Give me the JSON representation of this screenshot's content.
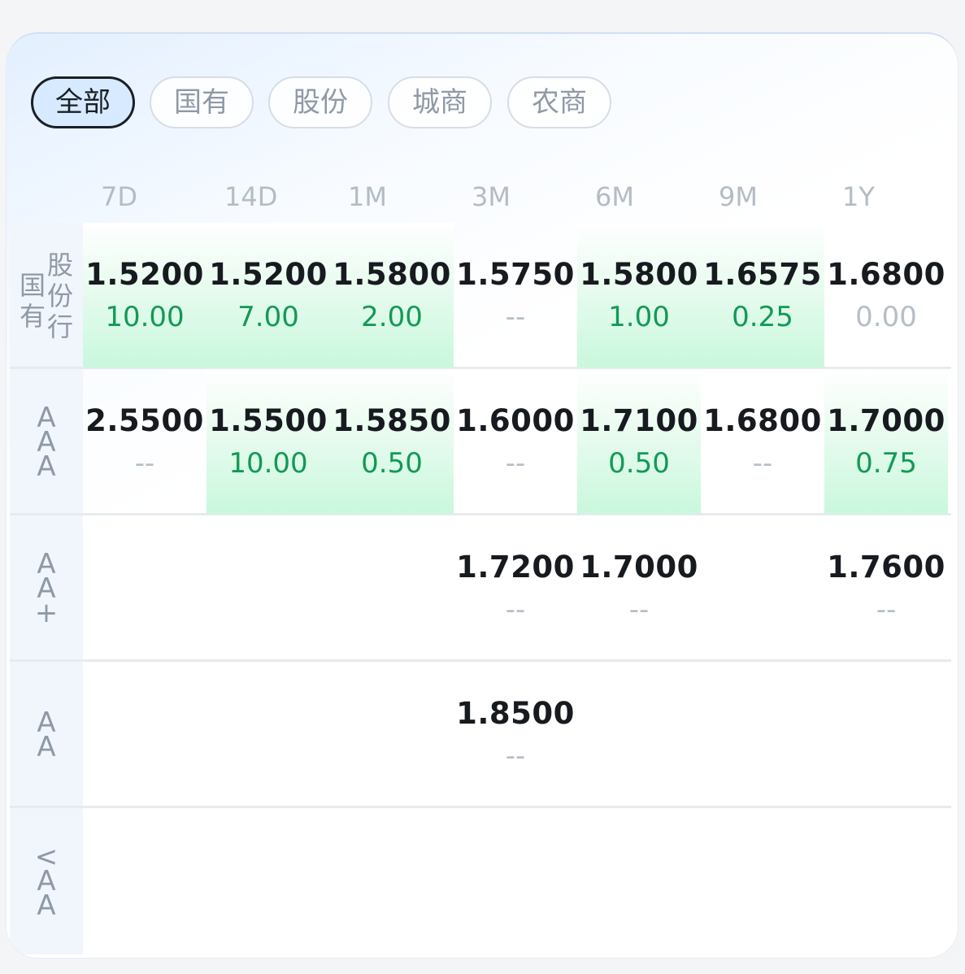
{
  "filters": [
    {
      "label": "全部",
      "active": true
    },
    {
      "label": "国有",
      "active": false
    },
    {
      "label": "股份",
      "active": false
    },
    {
      "label": "城商",
      "active": false
    },
    {
      "label": "农商",
      "active": false
    }
  ],
  "columns": [
    "7D",
    "14D",
    "1M",
    "3M",
    "6M",
    "9M",
    "1Y"
  ],
  "rows": [
    {
      "label_a": "国\n有",
      "label_b": "股\n份\n行",
      "cells": [
        {
          "value": "1.5200",
          "sub": "10.00",
          "state": "green"
        },
        {
          "value": "1.5200",
          "sub": "7.00",
          "state": "green"
        },
        {
          "value": "1.5800",
          "sub": "2.00",
          "state": "green"
        },
        {
          "value": "1.5750",
          "sub": "--",
          "state": "muted"
        },
        {
          "value": "1.5800",
          "sub": "1.00",
          "state": "green"
        },
        {
          "value": "1.6575",
          "sub": "0.25",
          "state": "green"
        },
        {
          "value": "1.6800",
          "sub": "0.00",
          "state": "muted"
        }
      ]
    },
    {
      "label_a": "A\nA\nA",
      "cells": [
        {
          "value": "2.5500",
          "sub": "--",
          "state": "muted"
        },
        {
          "value": "1.5500",
          "sub": "10.00",
          "state": "green"
        },
        {
          "value": "1.5850",
          "sub": "0.50",
          "state": "green"
        },
        {
          "value": "1.6000",
          "sub": "--",
          "state": "muted"
        },
        {
          "value": "1.7100",
          "sub": "0.50",
          "state": "green"
        },
        {
          "value": "1.6800",
          "sub": "--",
          "state": "muted"
        },
        {
          "value": "1.7000",
          "sub": "0.75",
          "state": "green"
        }
      ]
    },
    {
      "label_a": "A\nA\n+",
      "cells": [
        {
          "value": "",
          "sub": "",
          "state": "empty"
        },
        {
          "value": "",
          "sub": "",
          "state": "empty"
        },
        {
          "value": "",
          "sub": "",
          "state": "empty"
        },
        {
          "value": "1.7200",
          "sub": "--",
          "state": "muted"
        },
        {
          "value": "1.7000",
          "sub": "--",
          "state": "muted"
        },
        {
          "value": "",
          "sub": "",
          "state": "empty"
        },
        {
          "value": "1.7600",
          "sub": "--",
          "state": "muted"
        }
      ]
    },
    {
      "label_a": "A\nA",
      "cells": [
        {
          "value": "",
          "sub": "",
          "state": "empty"
        },
        {
          "value": "",
          "sub": "",
          "state": "empty"
        },
        {
          "value": "",
          "sub": "",
          "state": "empty"
        },
        {
          "value": "1.8500",
          "sub": "--",
          "state": "muted"
        },
        {
          "value": "",
          "sub": "",
          "state": "empty"
        },
        {
          "value": "",
          "sub": "",
          "state": "empty"
        },
        {
          "value": "",
          "sub": "",
          "state": "empty"
        }
      ]
    },
    {
      "label_a": "<\nA\nA",
      "cells": [
        {
          "value": "",
          "sub": "",
          "state": "empty"
        },
        {
          "value": "",
          "sub": "",
          "state": "empty"
        },
        {
          "value": "",
          "sub": "",
          "state": "empty"
        },
        {
          "value": "",
          "sub": "",
          "state": "empty"
        },
        {
          "value": "",
          "sub": "",
          "state": "empty"
        },
        {
          "value": "",
          "sub": "",
          "state": "empty"
        },
        {
          "value": "",
          "sub": "",
          "state": "empty"
        }
      ]
    }
  ],
  "colors": {
    "positive": "#129a55",
    "muted": "#b6bec8",
    "active_chip_bg": "#d8eaff"
  }
}
